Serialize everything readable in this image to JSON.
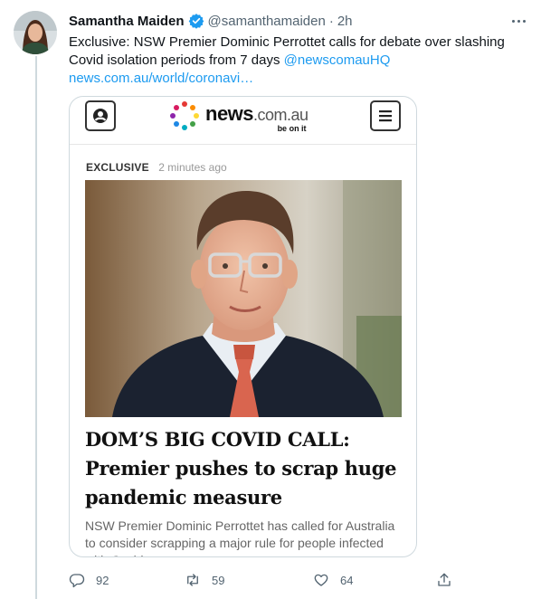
{
  "tweet": {
    "author_name": "Samantha Maiden",
    "handle": "@samanthamaiden",
    "separator": "·",
    "time": "2h",
    "text": "Exclusive: NSW Premier Dominic Perrottet calls for debate over slashing Covid isolation periods from 7 days",
    "mention": "@newscomauHQ",
    "link": "news.com.au/world/coronavi…"
  },
  "card": {
    "logo_news": "news",
    "logo_domain": ".com.au",
    "logo_tagline": "be on it",
    "tag_label": "EXCLUSIVE",
    "tag_time": "2 minutes ago",
    "headline": "DOM’S BIG COVID CALL: Premier pushes to scrap huge pandemic measure",
    "summary": "NSW Premier Dominic Perrottet has called for Australia to consider scrapping a major rule for people infected with Covid"
  },
  "actions": {
    "reply_count": "92",
    "retweet_count": "59",
    "like_count": "64"
  },
  "colors": {
    "accent": "#1d9bf0",
    "text": "#0f1419",
    "muted": "#536471"
  },
  "icons": [
    "verified-badge-icon",
    "more-icon",
    "account-icon",
    "menu-icon",
    "reply-icon",
    "retweet-icon",
    "like-icon",
    "share-icon"
  ]
}
